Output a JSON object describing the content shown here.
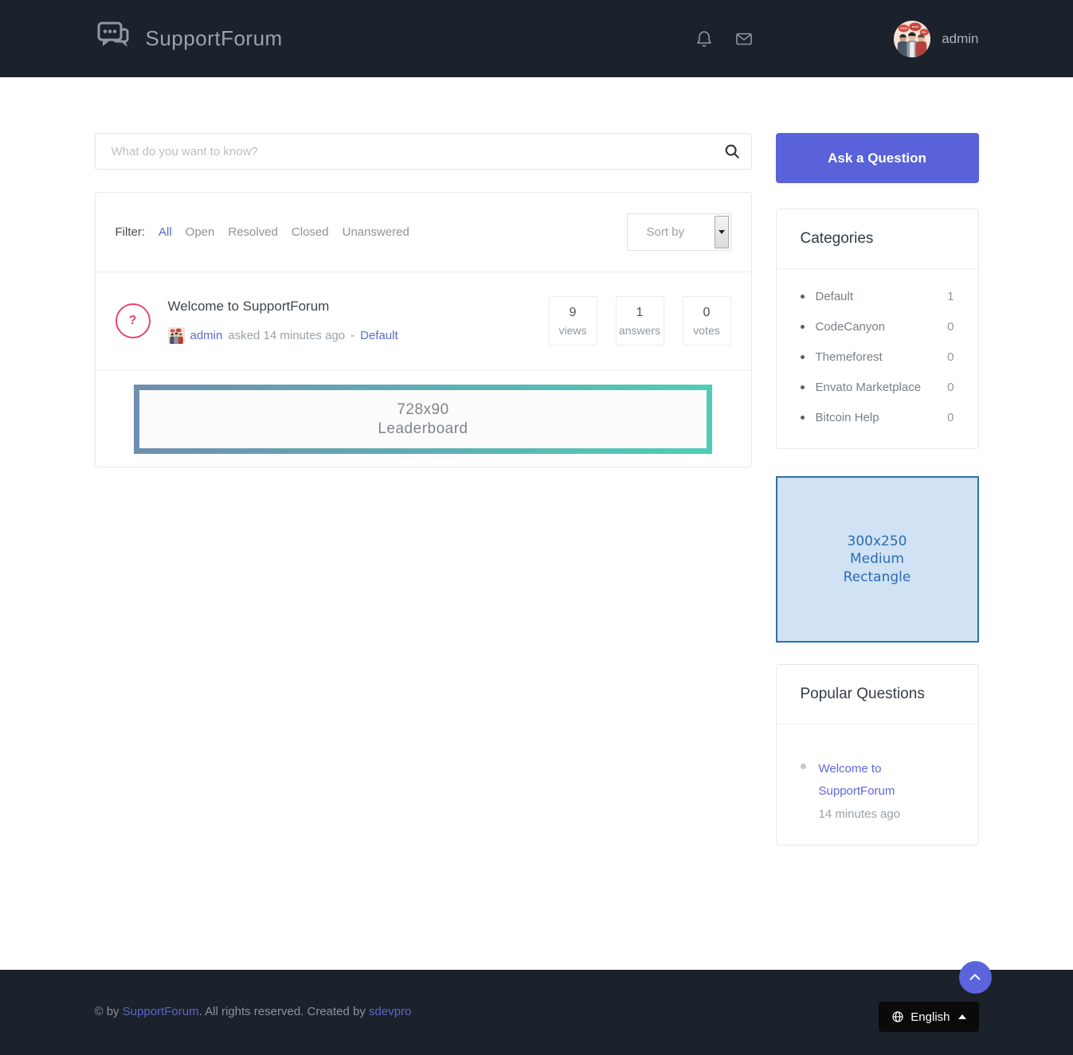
{
  "header": {
    "brand": "SupportForum",
    "username": "admin"
  },
  "search": {
    "placeholder": "What do you want to know?"
  },
  "filters": {
    "label": "Filter:",
    "items": [
      "All",
      "Open",
      "Resolved",
      "Closed",
      "Unanswered"
    ],
    "active": "All",
    "sort_label": "Sort by"
  },
  "question": {
    "icon_glyph": "?",
    "title": "Welcome to SupportForum",
    "author": "admin",
    "meta_text": "asked 14 minutes ago",
    "separator": "-",
    "category": "Default",
    "stats": [
      {
        "value": "9",
        "label": "views"
      },
      {
        "value": "1",
        "label": "answers"
      },
      {
        "value": "0",
        "label": "votes"
      }
    ]
  },
  "ads": {
    "leaderboard": {
      "line1": "728x90",
      "line2": "Leaderboard"
    },
    "rectangle": {
      "line1": "300x250",
      "line2": "Medium",
      "line3": "Rectangle"
    }
  },
  "sidebar": {
    "ask_button": "Ask a Question",
    "categories": {
      "title": "Categories",
      "items": [
        {
          "name": "Default",
          "count": "1"
        },
        {
          "name": "CodeCanyon",
          "count": "0"
        },
        {
          "name": "Themeforest",
          "count": "0"
        },
        {
          "name": "Envato Marketplace",
          "count": "0"
        },
        {
          "name": "Bitcoin Help",
          "count": "0"
        }
      ]
    },
    "popular": {
      "title": "Popular Questions",
      "items": [
        {
          "title": "Welcome to SupportForum",
          "time": "14 minutes ago"
        }
      ]
    }
  },
  "footer": {
    "prefix": "© by ",
    "brand_link": "SupportForum",
    "middle": ". All rights reserved. Created by ",
    "creator_link": "sdevpro",
    "language": "English"
  },
  "colors": {
    "header_bg": "#1b222b",
    "accent": "#5962d9",
    "question_icon": "#e5466b",
    "leaderboard_gradient_left": "#6e8fae",
    "leaderboard_gradient_right": "#50cdb7",
    "rect_ad_bg": "#d0e2f4",
    "rect_ad_border": "#2f70ab"
  }
}
